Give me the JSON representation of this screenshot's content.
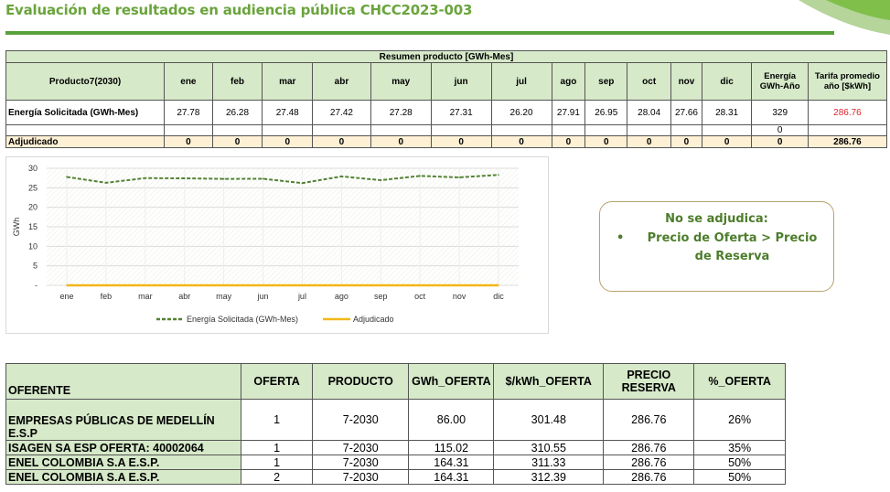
{
  "header": {
    "title": "Evaluación de resultados en audiencia pública CHCC2023-003"
  },
  "summary": {
    "caption": "Resumen producto [GWh-Mes]",
    "product_label": "Producto7(2030)",
    "months": [
      "ene",
      "feb",
      "mar",
      "abr",
      "may",
      "jun",
      "jul",
      "ago",
      "sep",
      "oct",
      "nov",
      "dic"
    ],
    "energia_header": "Energía GWh-Año",
    "tarifa_header": "Tarifa promedio año [$kWh]",
    "rows": [
      {
        "label": "Energía Solicitada (GWh-Mes)",
        "values": [
          "27.78",
          "26.28",
          "27.48",
          "27.42",
          "27.28",
          "27.31",
          "26.20",
          "27.91",
          "26.95",
          "28.04",
          "27.66",
          "28.31"
        ],
        "energia": "329",
        "tarifa": "286.76"
      },
      {
        "label": "",
        "values": [
          "",
          "",
          "",
          "",
          "",
          "",
          "",
          "",
          "",
          "",
          "",
          ""
        ],
        "energia": "0",
        "tarifa": ""
      },
      {
        "label": "Adjudicado",
        "values": [
          "0",
          "0",
          "0",
          "0",
          "0",
          "0",
          "0",
          "0",
          "0",
          "0",
          "0",
          "0"
        ],
        "energia": "0",
        "tarifa": "286.76"
      }
    ]
  },
  "chart_data": {
    "type": "line",
    "categories": [
      "ene",
      "feb",
      "mar",
      "abr",
      "may",
      "jun",
      "jul",
      "ago",
      "sep",
      "oct",
      "nov",
      "dic"
    ],
    "ylabel": "GWh",
    "ylim": [
      0,
      30
    ],
    "yticks": [
      "-",
      "5",
      "10",
      "15",
      "20",
      "25",
      "30"
    ],
    "series": [
      {
        "name": "Energía Solicitada (GWh-Mes)",
        "color": "#548235",
        "dash": true,
        "values": [
          27.78,
          26.28,
          27.48,
          27.42,
          27.28,
          27.31,
          26.2,
          27.91,
          26.95,
          28.04,
          27.66,
          28.31
        ]
      },
      {
        "name": "Adjudicado",
        "color": "#f2b718",
        "dash": false,
        "values": [
          0,
          0,
          0,
          0,
          0,
          0,
          0,
          0,
          0,
          0,
          0,
          0
        ]
      }
    ],
    "legend": "bottom"
  },
  "callout": {
    "heading": "No se adjudica:",
    "bullet": "•",
    "item": "Precio de Oferta > Precio de Reserva"
  },
  "offers": {
    "headers": [
      "OFERENTE",
      "OFERTA",
      "PRODUCTO",
      "GWh_OFERTA",
      "$/kWh_OFERTA",
      "PRECIO RESERVA",
      "%_OFERTA"
    ],
    "rows": [
      [
        "EMPRESAS PÚBLICAS DE MEDELLÍN E.S.P",
        "1",
        "7-2030",
        "86.00",
        "301.48",
        "286.76",
        "26%"
      ],
      [
        "ISAGEN SA ESP    OFERTA: 40002064",
        "1",
        "7-2030",
        "115.02",
        "310.55",
        "286.76",
        "35%"
      ],
      [
        "ENEL COLOMBIA S.A E.S.P.",
        "1",
        "7-2030",
        "164.31",
        "311.33",
        "286.76",
        "50%"
      ],
      [
        "ENEL COLOMBIA S.A E.S.P.",
        "2",
        "7-2030",
        "164.31",
        "312.39",
        "286.76",
        "50%"
      ]
    ]
  },
  "colors": {
    "accent": "#58a13a",
    "header_fill": "#d6e9c9",
    "adjudicado_fill": "#fdf0d5",
    "tarifa_red": "#e0242a"
  }
}
